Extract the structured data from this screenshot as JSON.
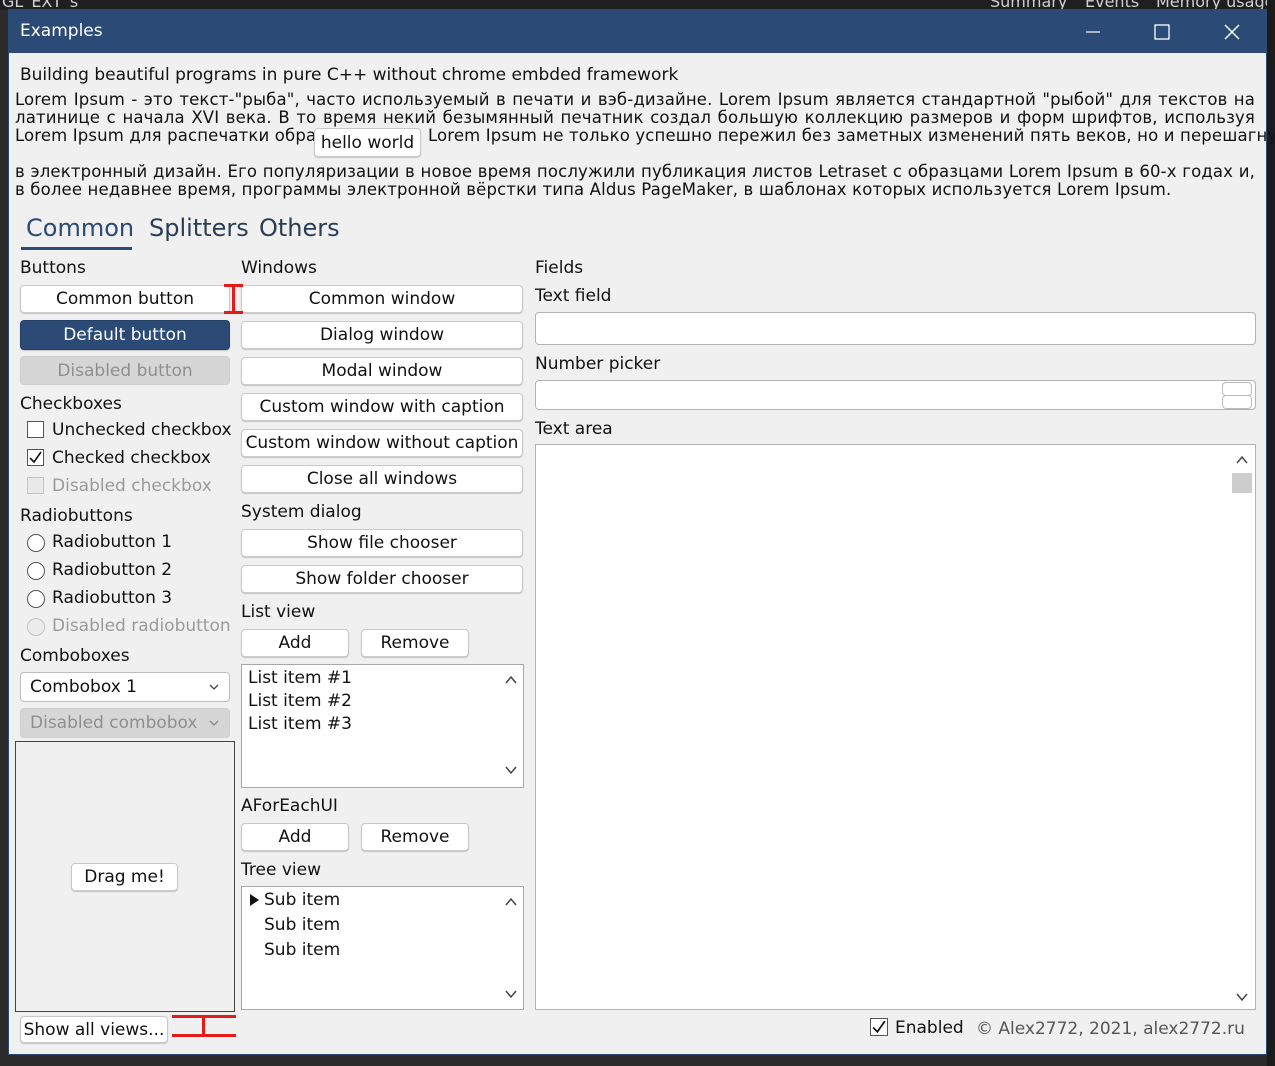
{
  "background": {
    "texts": [
      "GL_EXT_s",
      "Summary",
      "Events",
      "Memory usage"
    ]
  },
  "window": {
    "title": "Examples",
    "controls": {
      "minimize": "minimize-icon",
      "maximize": "maximize-icon",
      "close": "close-icon"
    }
  },
  "intro": {
    "heading": "Building beautiful programs in pure C++ without chrome embded framework",
    "lorem_part1": "Lorem Ipsum - это текст-\"рыба\", часто используемый в печати и вэб-дизайне. Lorem Ipsum является стандартной \"рыбой\" для текстов на латинице с начала XVI века. В то время некий безымянный печатник создал большую коллекцию размеров и форм шрифтов, используя Lorem Ipsum для распечатки образцов.",
    "hello_button": "hello world",
    "lorem_part2": "Lorem Ipsum не только успешно пережил без заметных изменений пять веков, но и перешагнул",
    "lorem_part3": "в электронный дизайн. Его популяризации в новое время послужили публикация листов Letraset с образцами Lorem Ipsum в 60-х годах и, в более недавнее время, программы электронной вёрстки типа Aldus PageMaker, в шаблонах которых используется Lorem Ipsum."
  },
  "tabs": [
    {
      "label": "Common",
      "active": true
    },
    {
      "label": "Splitters",
      "active": false
    },
    {
      "label": "Others",
      "active": false
    }
  ],
  "buttons_section": {
    "title": "Buttons",
    "common": "Common button",
    "default": "Default button",
    "disabled": "Disabled button"
  },
  "checkboxes_section": {
    "title": "Checkboxes",
    "items": [
      {
        "label": "Unchecked checkbox",
        "checked": false,
        "disabled": false
      },
      {
        "label": "Checked checkbox",
        "checked": true,
        "disabled": false
      },
      {
        "label": "Disabled checkbox",
        "checked": false,
        "disabled": true
      }
    ]
  },
  "radio_section": {
    "title": "Radiobuttons",
    "items": [
      {
        "label": "Radiobutton 1",
        "disabled": false
      },
      {
        "label": "Radiobutton 2",
        "disabled": false
      },
      {
        "label": "Radiobutton 3",
        "disabled": false
      },
      {
        "label": "Disabled radiobutton",
        "disabled": true
      }
    ]
  },
  "combobox_section": {
    "title": "Comboboxes",
    "combo1": "Combobox 1",
    "disabled_combo": "Disabled combobox"
  },
  "drag": {
    "button": "Drag me!"
  },
  "show_all": "Show all views...",
  "windows_section": {
    "title": "Windows",
    "buttons": [
      "Common window",
      "Dialog window",
      "Modal window",
      "Custom window with caption",
      "Custom window without caption",
      "Close all windows"
    ]
  },
  "system_dialog": {
    "title": "System dialog",
    "buttons": [
      "Show file chooser",
      "Show folder chooser"
    ]
  },
  "list_view": {
    "title": "List view",
    "add": "Add",
    "remove": "Remove",
    "items": [
      "List item #1",
      "List item #2",
      "List item #3"
    ]
  },
  "aforeach": {
    "title": "AForEachUI",
    "add": "Add",
    "remove": "Remove"
  },
  "tree_view": {
    "title": "Tree view",
    "items": [
      "Sub item",
      "Sub item",
      "Sub item"
    ]
  },
  "fields": {
    "title": "Fields",
    "text_field_label": "Text field",
    "text_field_value": "",
    "number_picker_label": "Number picker",
    "number_picker_value": "",
    "text_area_label": "Text area",
    "text_area_value": ""
  },
  "footer": {
    "enabled_label": "Enabled",
    "enabled_checked": true,
    "copyright": "© Alex2772, 2021, alex2772.ru"
  },
  "colors": {
    "accent": "#2b4a76",
    "window_bg": "#f0f0f0",
    "annotation": "#e31b1b"
  }
}
